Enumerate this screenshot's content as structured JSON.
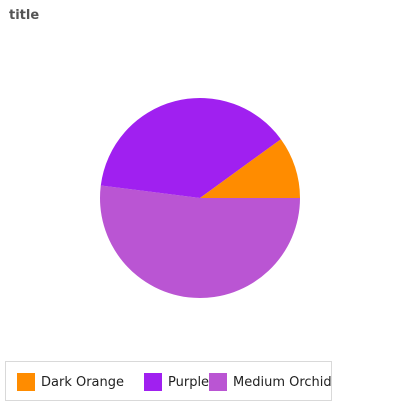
{
  "chart_data": {
    "type": "pie",
    "title": "title",
    "categories": [
      "Dark Orange",
      "Purple",
      "Medium Orchid"
    ],
    "values": [
      10,
      38,
      52
    ],
    "colors": [
      "#ff8c00",
      "#a020f0",
      "#ba55d3"
    ],
    "legend_position": "bottom-left"
  }
}
